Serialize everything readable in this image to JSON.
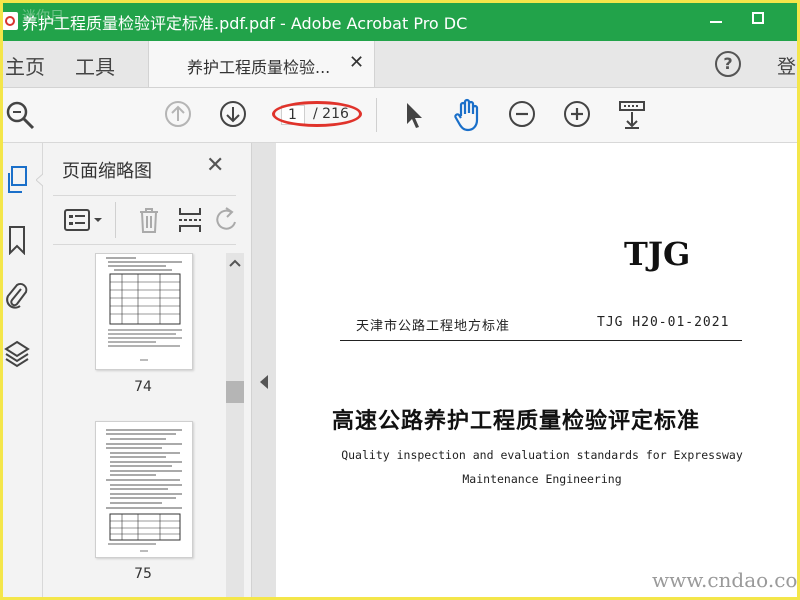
{
  "window": {
    "title": "养护工程质量检验评定标准.pdf.pdf - Adobe Acrobat Pro DC",
    "titlebar_color": "#22a34a"
  },
  "tabs": {
    "home": "主页",
    "tools": "工具",
    "document_tab": "养护工程质量检验...",
    "sign_in": "登"
  },
  "toolbar": {
    "current_page": "1",
    "total_pages": "/ 216",
    "highlight_color": "#e0332b"
  },
  "panel": {
    "title": "页面缩略图",
    "thumbnails": [
      {
        "page_label": "74"
      },
      {
        "page_label": "75"
      }
    ]
  },
  "document": {
    "mark": "TJG",
    "standard_org": "天津市公路工程地方标准",
    "standard_code": "TJG H20-01-2021",
    "title_cn": "高速公路养护工程质量检验评定标准",
    "title_en_line1": "Quality inspection and evaluation standards for Expressway",
    "title_en_line2": "Maintenance Engineering"
  },
  "watermark": {
    "text": "www.cndao.com"
  },
  "icons": [
    "pdf-app-icon",
    "minimize-icon",
    "maximize-icon",
    "tab-close-icon",
    "help-icon",
    "search-zoom-icon",
    "prev-page-icon",
    "next-page-icon",
    "select-cursor-icon",
    "hand-tool-icon",
    "zoom-out-icon",
    "zoom-in-icon",
    "scroll-mode-icon",
    "page-thumbnails-icon",
    "bookmark-icon",
    "attachment-icon",
    "layers-icon",
    "panel-close-icon",
    "thumbnail-options-icon",
    "delete-icon",
    "extract-icon",
    "rotate-icon"
  ]
}
